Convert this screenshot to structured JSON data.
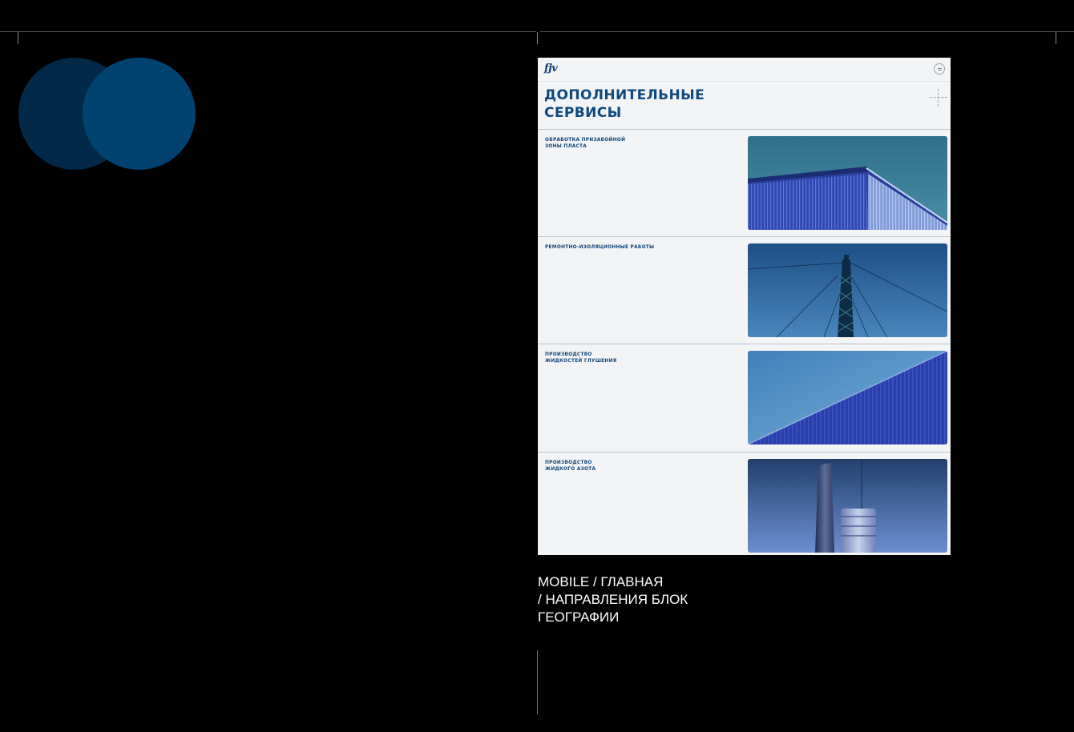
{
  "phone": {
    "logo": "fjv",
    "section_title": "ДОПОЛНИТЕЛЬНЫЕ\nСЕРВИСЫ",
    "services": [
      {
        "label": "ОБРАБОТКА ПРИЗАБОЙНОЙ\nЗОНЫ ПЛАСТА",
        "photo": "industrial-building-roof-photo"
      },
      {
        "label": "РЕМОНТНО-ИЗОЛЯЦИОННЫЕ РАБОТЫ",
        "photo": "drilling-rig-tower-photo"
      },
      {
        "label": "ПРОИЗВОДСТВО\nЖИДКОСТЕЙ ГЛУШЕНИЯ",
        "photo": "corrugated-wall-photo"
      },
      {
        "label": "ПРОИЗВОДСТВО\nЖИДКОГО АЗОТА",
        "photo": "chimney-and-tank-photo"
      }
    ],
    "icons": {
      "menu": "menu-icon",
      "crosshair": "crosshair-icon"
    }
  },
  "caption": "MOBILE / ГЛАВНАЯ\n/ НАПРАВЛЕНИЯ БЛОК\nГЕОГРАФИИ",
  "colors": {
    "background": "#000000",
    "circle_dark": "#022a48",
    "circle_bright": "#004371",
    "phone_background": "#f3f4f6",
    "accent_text": "#0e4a7e",
    "divider": "#b7c2d1"
  }
}
